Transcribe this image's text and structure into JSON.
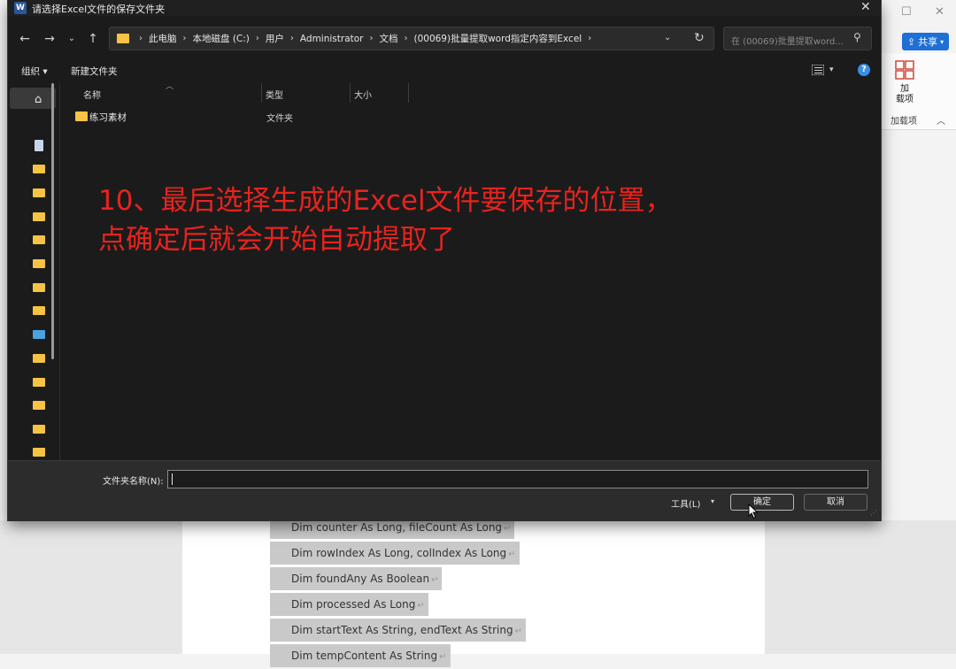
{
  "dialog": {
    "title": "请选择Excel文件的保存文件夹",
    "app_icon": "W",
    "breadcrumbs": [
      "此电脑",
      "本地磁盘 (C:)",
      "用户",
      "Administrator",
      "文档",
      "(00069)批量提取word指定内容到Excel"
    ],
    "search_placeholder": "在 (00069)批量提取word...",
    "toolbar": {
      "organize": "组织 ▾",
      "new_folder": "新建文件夹"
    },
    "columns": {
      "name": "名称",
      "type": "类型",
      "size": "大小"
    },
    "files": [
      {
        "name": "练习素材",
        "type": "文件夹"
      }
    ],
    "folder_name_label": "文件夹名称(N):",
    "folder_name_value": "",
    "tools_label": "工具(L)",
    "ok_label": "确定",
    "cancel_label": "取消"
  },
  "annotation": {
    "line1": "10、最后选择生成的Excel文件要保存的位置，",
    "line2": "点确定后就会开始自动提取了"
  },
  "word": {
    "share_label": "共享",
    "addin_label": "加\n载项",
    "addin_group": "加载项",
    "code_lines": [
      "Dim counter As Long, fileCount As Long",
      "Dim rowIndex As Long, colIndex As Long",
      "Dim foundAny As Boolean",
      "Dim processed As Long",
      "Dim startText As String, endText As String",
      "Dim tempContent As String"
    ],
    "para_mark": "↵"
  }
}
